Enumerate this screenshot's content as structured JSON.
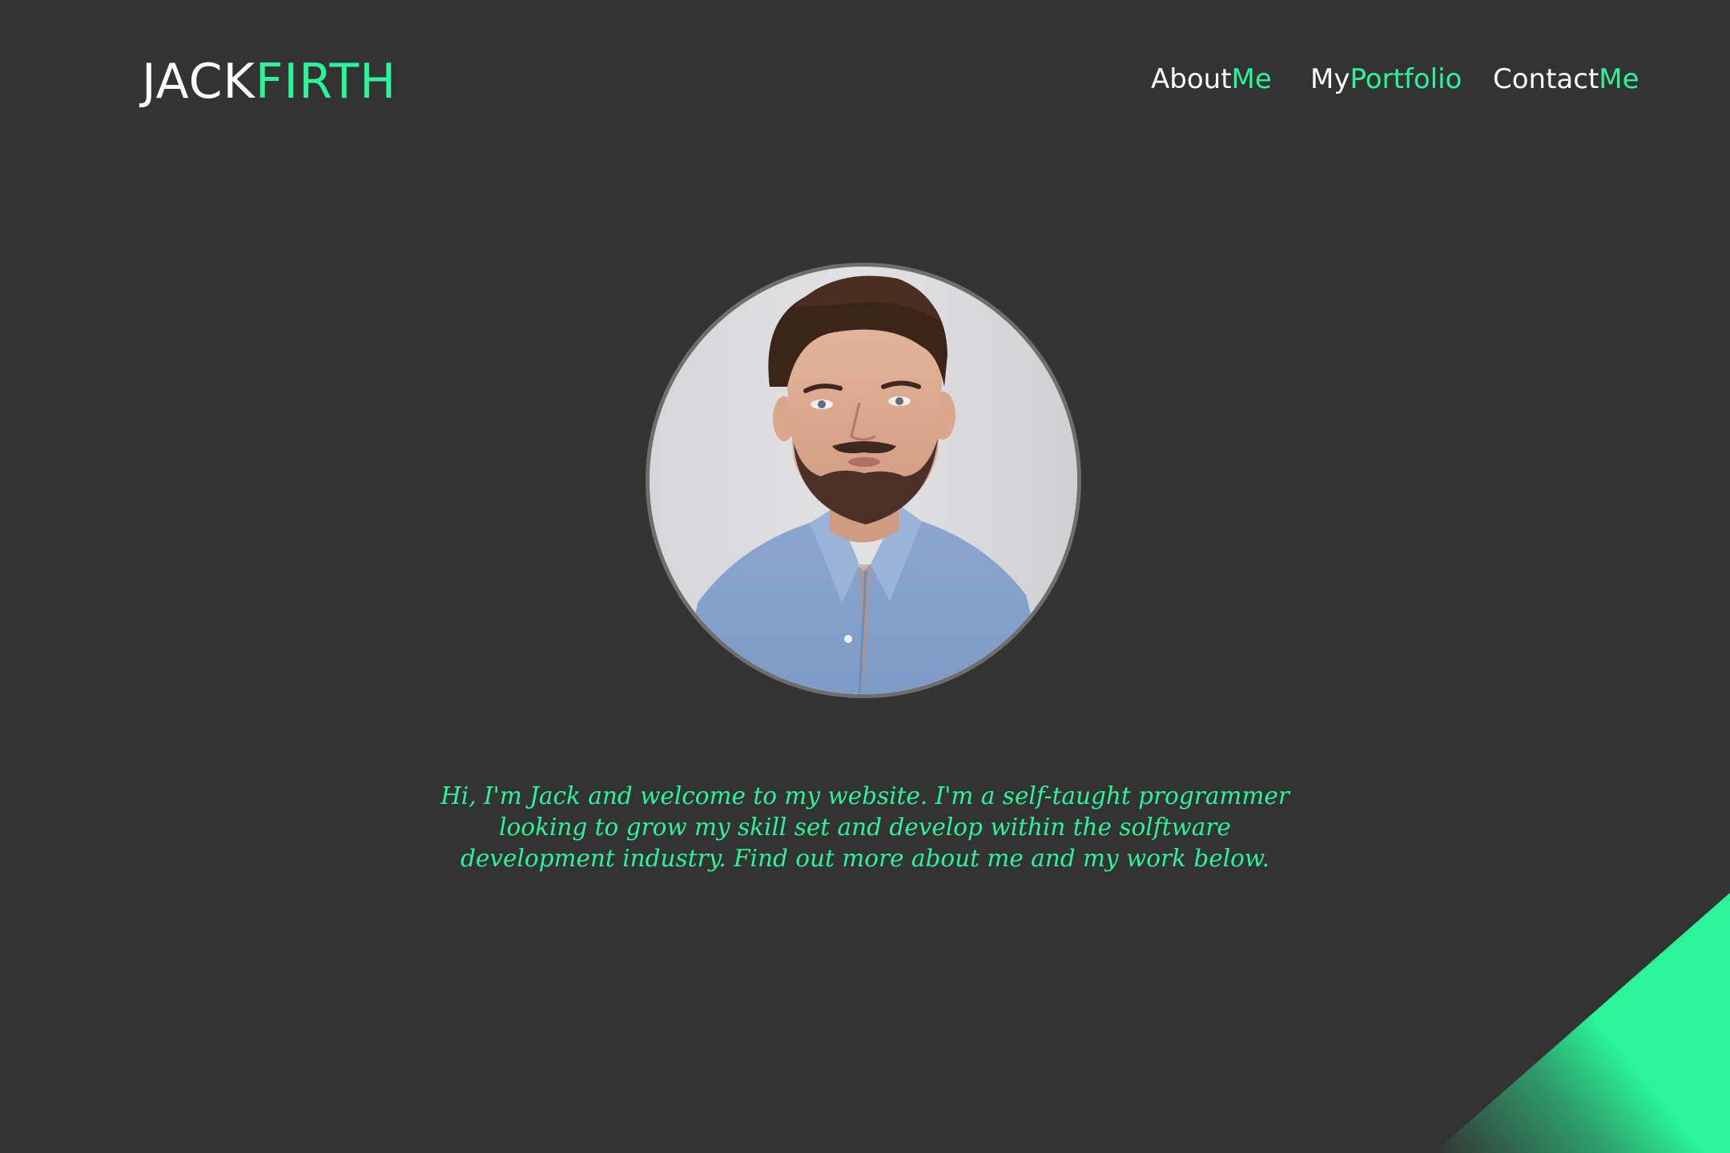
{
  "header": {
    "logo_first": "JACK",
    "logo_last": "FIRTH"
  },
  "nav": {
    "items": [
      {
        "part1": "About",
        "part2": "Me"
      },
      {
        "part1": "My",
        "part2": "Portfolio"
      },
      {
        "part1": "Contact",
        "part2": "Me"
      }
    ]
  },
  "hero": {
    "intro": "Hi, I'm Jack and welcome to my website. I'm a self-taught programmer looking to grow my skill set and develop within the solftware development industry. Find out more about me and my work below."
  },
  "colors": {
    "background": "#333333",
    "accent": "#2af598",
    "text": "#ffffff"
  }
}
